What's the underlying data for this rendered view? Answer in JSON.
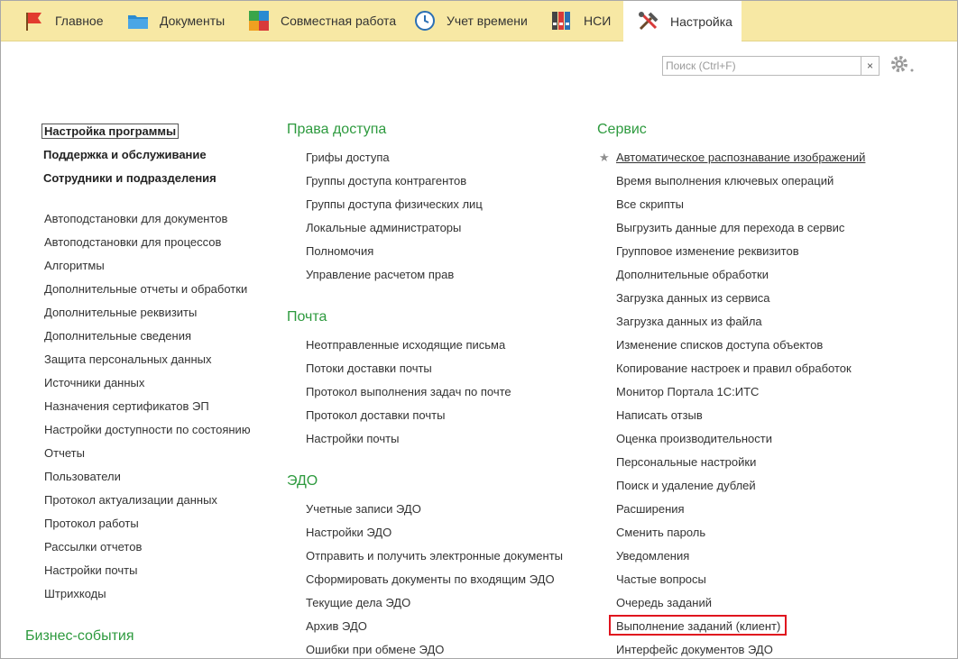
{
  "tabs": [
    {
      "label": "Главное",
      "icon": "flag-icon"
    },
    {
      "label": "Документы",
      "icon": "folder-icon"
    },
    {
      "label": "Совместная работа",
      "icon": "puzzle-icon"
    },
    {
      "label": "Учет времени",
      "icon": "clock-icon"
    },
    {
      "label": "НСИ",
      "icon": "binders-icon"
    },
    {
      "label": "Настройка",
      "icon": "tools-icon",
      "active": true
    }
  ],
  "search": {
    "placeholder": "Поиск (Ctrl+F)",
    "value": "",
    "clear": "×"
  },
  "left_column": {
    "top_items": [
      "Настройка программы",
      "Поддержка и обслуживание",
      "Сотрудники и подразделения"
    ],
    "items": [
      "Автоподстановки для документов",
      "Автоподстановки для процессов",
      "Алгоритмы",
      "Дополнительные отчеты и обработки",
      "Дополнительные реквизиты",
      "Дополнительные сведения",
      "Защита персональных данных",
      "Источники данных",
      "Назначения сертификатов ЭП",
      "Настройки доступности по состоянию",
      "Отчеты",
      "Пользователи",
      "Протокол актуализации данных",
      "Протокол работы",
      "Рассылки отчетов",
      "Настройки почты",
      "Штрихкоды"
    ],
    "bottom_section": "Бизнес-события"
  },
  "middle_column": {
    "sections": [
      {
        "title": "Права доступа",
        "items": [
          "Грифы доступа",
          "Группы доступа контрагентов",
          "Группы доступа физических лиц",
          "Локальные администраторы",
          "Полномочия",
          "Управление расчетом прав"
        ]
      },
      {
        "title": "Почта",
        "items": [
          "Неотправленные исходящие письма",
          "Потоки доставки почты",
          "Протокол выполнения задач по почте",
          "Протокол доставки почты",
          "Настройки почты"
        ]
      },
      {
        "title": "ЭДО",
        "items": [
          "Учетные записи ЭДО",
          "Настройки ЭДО",
          "Отправить и получить электронные документы",
          "Сформировать документы по входящим ЭДО",
          "Текущие дела ЭДО",
          "Архив ЭДО",
          "Ошибки при обмене ЭДО"
        ]
      }
    ]
  },
  "right_column": {
    "title": "Сервис",
    "items": [
      "Автоматическое распознавание изображений",
      "Время выполнения ключевых операций",
      "Все скрипты",
      "Выгрузить данные для перехода в сервис",
      "Групповое изменение реквизитов",
      "Дополнительные обработки",
      "Загрузка данных из сервиса",
      "Загрузка данных из файла",
      "Изменение списков доступа объектов",
      "Копирование настроек и правил обработок",
      "Монитор Портала 1С:ИТС",
      "Написать отзыв",
      "Оценка производительности",
      "Персональные настройки",
      "Поиск и удаление дублей",
      "Расширения",
      "Сменить пароль",
      "Уведомления",
      "Частые вопросы",
      "Очередь заданий",
      "Выполнение заданий (клиент)",
      "Интерфейс документов ЭДО"
    ],
    "favorite_icon": "star-icon"
  },
  "colors": {
    "tabbar": "#f7e8a4",
    "section_title": "#2d9a3e",
    "highlight": "#e0141e"
  }
}
